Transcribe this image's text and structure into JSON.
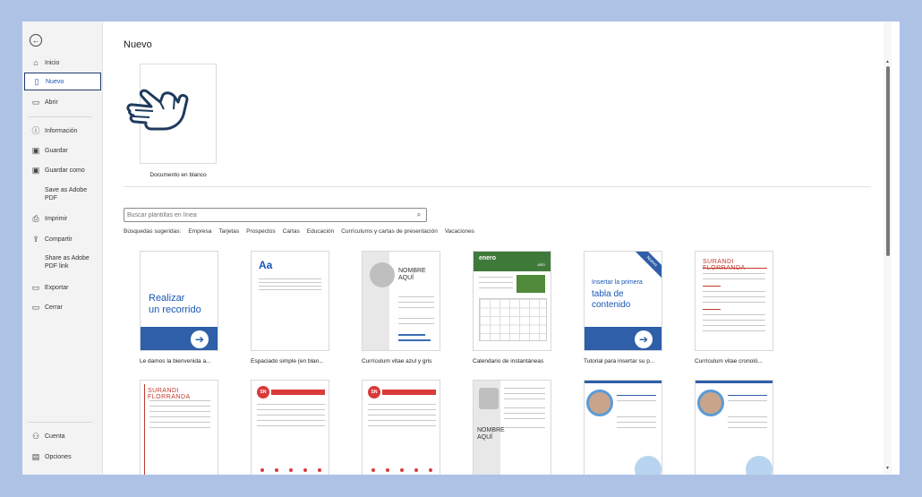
{
  "sidebar": {
    "back_icon": "back-arrow-icon",
    "items": [
      {
        "label": "Inicio",
        "icon": "home-icon"
      },
      {
        "label": "Nuevo",
        "icon": "new-document-icon",
        "active": true
      },
      {
        "label": "Abrir",
        "icon": "folder-icon"
      },
      {
        "label": "Información",
        "icon": "info-icon"
      },
      {
        "label": "Guardar",
        "icon": "save-icon"
      },
      {
        "label": "Guardar como",
        "icon": "save-as-icon"
      },
      {
        "label": "Save as Adobe PDF"
      },
      {
        "label": "Imprimir",
        "icon": "printer-icon"
      },
      {
        "label": "Compartir",
        "icon": "share-icon"
      },
      {
        "label": "Share as Adobe PDF link"
      },
      {
        "label": "Exportar",
        "icon": "export-icon"
      },
      {
        "label": "Cerrar",
        "icon": "close-folder-icon"
      }
    ],
    "bottom_items": [
      {
        "label": "Cuenta",
        "icon": "account-icon"
      },
      {
        "label": "Opciones",
        "icon": "options-icon"
      }
    ]
  },
  "main": {
    "title": "Nuevo",
    "blank_document_label": "Documento en blanco",
    "search": {
      "placeholder": "Buscar plantillas en línea",
      "icon": "search-icon"
    },
    "suggested_label": "Búsquedas sugeridas:",
    "suggested": [
      "Empresa",
      "Tarjetas",
      "Prospectos",
      "Cartas",
      "Educación",
      "Currículums y cartas de presentación",
      "Vacaciones"
    ],
    "templates": [
      {
        "label": "Le damos la bienvenida a...",
        "text_line1": "Realizar",
        "text_line2": "un recorrido"
      },
      {
        "label": "Espaciado simple (en blan...",
        "text": "Aa"
      },
      {
        "label": "Currículum vitae azul y gris",
        "name_line1": "NOMBRE",
        "name_line2": "AQUÍ"
      },
      {
        "label": "Calendario de instantáneas",
        "month": "enero",
        "year": "AÑO"
      },
      {
        "label": "Tutorial para insertar su p...",
        "text_line1": "Insertar la primera",
        "text_line2": "tabla de",
        "text_line3": "contenido",
        "ribbon": "Nuevo"
      },
      {
        "label": "Currículum vitae cronoló...",
        "heading": "SURANDI FLORRANDA"
      }
    ],
    "row2": [
      {
        "heading": "SURANDI FLORRANDA"
      },
      {
        "initials": "SN"
      },
      {
        "initials": "SN"
      },
      {
        "name_line1": "NOMBRE",
        "name_line2": "AQUÍ"
      },
      {},
      {}
    ]
  },
  "colors": {
    "accent": "#1a56b4",
    "background": "#aec2e6",
    "red": "#d93a3a",
    "green": "#3f7a3a"
  }
}
